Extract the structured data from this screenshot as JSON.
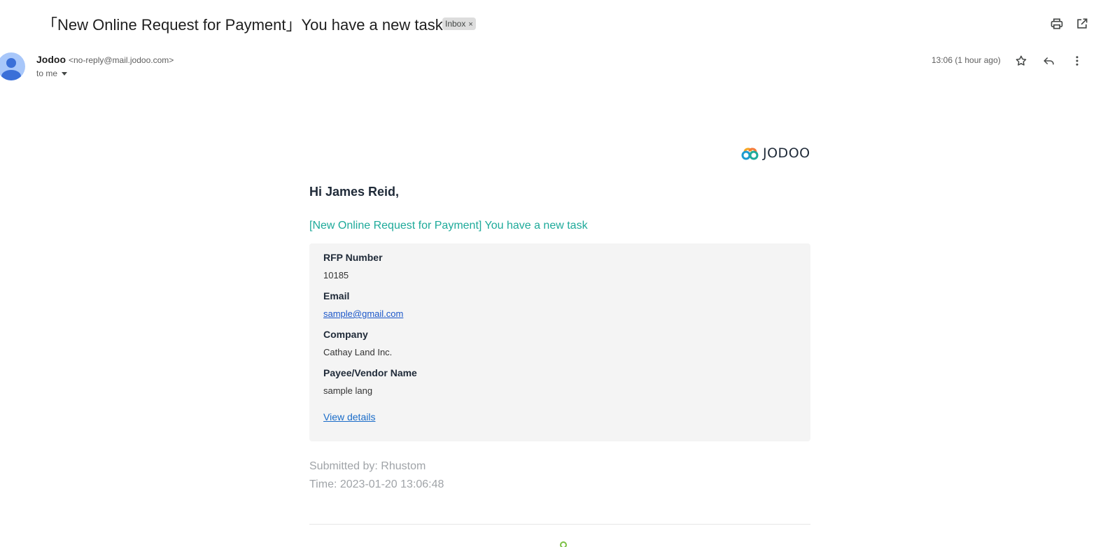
{
  "email": {
    "subject": "「New Online Request for Payment」You have a new task",
    "label_chip": "Inbox",
    "label_chip_close": "×",
    "sender_name": "Jodoo",
    "sender_email": "<no-reply@mail.jodoo.com>",
    "recipient": "to me",
    "timestamp": "13:06 (1 hour ago)"
  },
  "toolbar_icons": [
    "print-icon",
    "open-in-new-window-icon",
    "star-icon",
    "reply-icon",
    "more-vert-icon"
  ],
  "body": {
    "logo_text": "JODOO",
    "greeting": "Hi James Reid,",
    "task_title": "[New Online Request for Payment] You have a new task",
    "fields": [
      {
        "label": "RFP Number",
        "value": "10185"
      },
      {
        "label": "Email",
        "value": "sample@gmail.com"
      },
      {
        "label": "Company",
        "value": "Cathay Land Inc."
      },
      {
        "label": "Payee/Vendor Name",
        "value": "sample lang"
      }
    ],
    "view_details": "View details",
    "submitted_by": "Submitted by: Rhustom",
    "time": "Time: 2023-01-20 13:06:48"
  },
  "colors": {
    "accent_teal": "#1eaa9a",
    "link_blue": "#1a56c9",
    "card_bg": "#f4f4f4",
    "avatar_bg": "#a8c7fa"
  }
}
